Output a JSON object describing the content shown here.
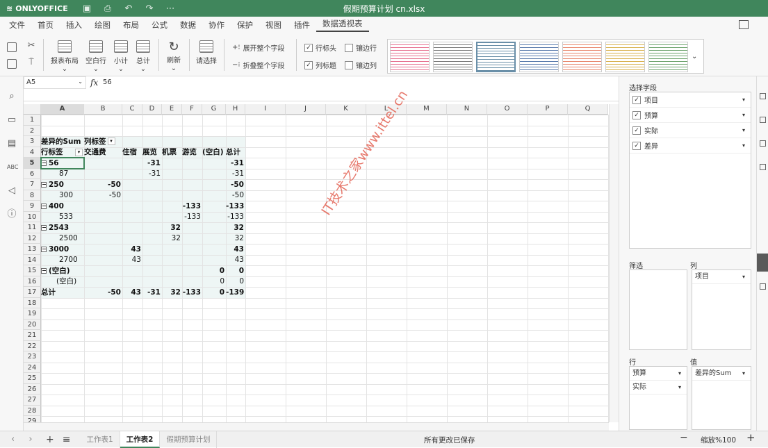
{
  "app": {
    "logo": "ONLYOFFICE",
    "title": "假期预算计划 cn.xlsx"
  },
  "menu": [
    "文件",
    "首页",
    "插入",
    "绘图",
    "布局",
    "公式",
    "数据",
    "协作",
    "保护",
    "视图",
    "插件",
    "数据透视表"
  ],
  "toolbar": {
    "report_layout": "报表布局",
    "blank_rows": "空白行",
    "subtotals": "小计",
    "grand_totals": "总计",
    "refresh": "刷新",
    "select": "请选择",
    "expand_field": "展开整个字段",
    "collapse_field": "折叠整个字段",
    "row_headers": "行标头",
    "col_headers": "列标题",
    "banded_rows": "镶边行",
    "banded_cols": "镶边列"
  },
  "formula": {
    "cell_ref": "A5",
    "fx": "fx",
    "value": "56"
  },
  "columns": [
    "A",
    "B",
    "C",
    "D",
    "E",
    "F",
    "G",
    "H",
    "I",
    "J",
    "K",
    "L",
    "M",
    "N",
    "O",
    "P",
    "Q"
  ],
  "rows": [
    "1",
    "2",
    "3",
    "4",
    "5",
    "6",
    "7",
    "8",
    "9",
    "10",
    "11",
    "12",
    "13",
    "14",
    "15",
    "16",
    "17",
    "18",
    "19",
    "20",
    "21",
    "22",
    "23",
    "24",
    "25",
    "26",
    "27",
    "28",
    "29"
  ],
  "pivot": {
    "r3": {
      "a": "差异的Sum",
      "b": "列标签"
    },
    "r4": {
      "a": "行标签",
      "b": "交通费",
      "c": "住宿",
      "d": "展览",
      "e": "机票",
      "f": "游览",
      "g": "(空白)",
      "h": "总计"
    },
    "r5": {
      "a": "56",
      "d": "-31",
      "h": "-31"
    },
    "r6": {
      "a": "87",
      "d": "-31",
      "h": "-31"
    },
    "r7": {
      "a": "250",
      "b": "-50",
      "h": "-50"
    },
    "r8": {
      "a": "300",
      "b": "-50",
      "h": "-50"
    },
    "r9": {
      "a": "400",
      "f": "-133",
      "h": "-133"
    },
    "r10": {
      "a": "533",
      "f": "-133",
      "h": "-133"
    },
    "r11": {
      "a": "2543",
      "e": "32",
      "h": "32"
    },
    "r12": {
      "a": "2500",
      "e": "32",
      "h": "32"
    },
    "r13": {
      "a": "3000",
      "c": "43",
      "h": "43"
    },
    "r14": {
      "a": "2700",
      "c": "43",
      "h": "43"
    },
    "r15": {
      "a": "(空白)",
      "g": "0",
      "h": "0"
    },
    "r16": {
      "a": "(空白)",
      "g": "0",
      "h": "0"
    },
    "r17": {
      "a": "总计",
      "b": "-50",
      "c": "43",
      "d": "-31",
      "e": "32",
      "f": "-133",
      "g": "0",
      "h": "-139"
    }
  },
  "watermark": "IT技术之家www.ittel.cn",
  "panel": {
    "select_fields": "选择字段",
    "fields": [
      "项目",
      "预算",
      "实际",
      "差异"
    ],
    "filter_label": "筛选",
    "columns_label": "列",
    "columns_items": [
      "项目"
    ],
    "rows_label": "行",
    "rows_items": [
      "预算",
      "实际"
    ],
    "values_label": "值",
    "values_items": [
      "差异的Sum"
    ]
  },
  "status": {
    "sheets": [
      "工作表1",
      "工作表2",
      "假期预算计划"
    ],
    "active_sheet": "工作表2",
    "saved": "所有更改已保存",
    "zoom": "缩放%100"
  },
  "colors": {
    "brand": "#40865c",
    "pivot_band": "#eef6f5"
  }
}
